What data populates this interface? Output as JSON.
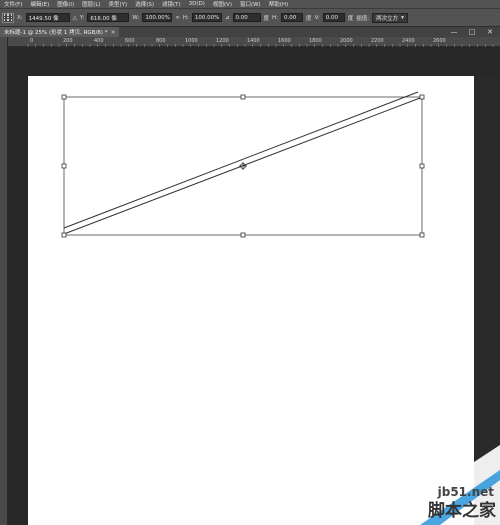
{
  "menu": [
    "文件(F)",
    "编辑(E)",
    "图像(I)",
    "图层(L)",
    "类型(Y)",
    "选择(S)",
    "滤镜(T)",
    "3D(D)",
    "视图(V)",
    "窗口(W)",
    "帮助(H)"
  ],
  "options": {
    "x_label": "X:",
    "x_value": "1449.50 像",
    "y_label": "Y:",
    "y_value": "616.00 像",
    "w_label": "W:",
    "w_value": "100.00%",
    "h_label": "H:",
    "h_value": "100.00%",
    "angle_value": "0.00",
    "angle_unit": "度",
    "hskew_label": "H:",
    "hskew_value": "0.00",
    "hskew_unit": "度",
    "vskew_label": "V:",
    "vskew_value": "0.00",
    "vskew_unit": "度",
    "interp_label": "插值:",
    "interp_value": "两次立方"
  },
  "window_controls": [
    "—",
    "□",
    "✕"
  ],
  "document_tab": {
    "title": "未标题-1 @ 25% (形状 1 拷贝, RGB/8) *"
  },
  "ruler_ticks": [
    "0",
    "200",
    "400",
    "600",
    "800",
    "1000",
    "1200",
    "1400",
    "1600",
    "1800",
    "2000",
    "2200",
    "2400",
    "2600"
  ],
  "watermark": {
    "url": "jb51.net",
    "name": "脚本之家"
  },
  "colors": {
    "chrome": "#535353",
    "workspace": "#282828",
    "canvas": "#ffffff",
    "watermark_blue": "#1e8fd8"
  }
}
